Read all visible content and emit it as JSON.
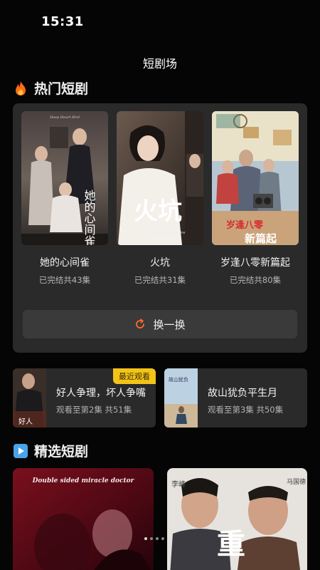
{
  "status": {
    "time": "15:31"
  },
  "page": {
    "title": "短剧场"
  },
  "hot": {
    "heading": "热门短剧",
    "icon": "fire-icon",
    "items": [
      {
        "title": "她的心间雀",
        "sub": "已完结共43集",
        "poster_text": "她的心间雀",
        "poster_tag": "Deep Heart Bird"
      },
      {
        "title": "火坑",
        "sub": "已完结共31集",
        "poster_text": "火坑",
        "poster_tag": "Salvation by the Fire"
      },
      {
        "title": "岁逢八零新篇起",
        "sub": "已完结共80集",
        "poster_text": "岁逢八零 新篇起"
      }
    ],
    "refresh_label": "换一换"
  },
  "recent": [
    {
      "title": "好人争理，坏人争嘴",
      "sub": "观看至第2集 共51集",
      "badge": "最近观看"
    },
    {
      "title": "故山犹负平生月",
      "sub": "观看至第3集 共50集"
    }
  ],
  "picks": {
    "heading": "精选短剧",
    "icon": "play-icon",
    "cards": [
      {
        "poster_text": "Double sided miracle doctor"
      },
      {
        "poster_text": "重",
        "names": [
          "李峰",
          "马国德"
        ]
      }
    ]
  },
  "colors": {
    "background": "#050505",
    "panel": "#2a2a2a",
    "accent": "#f2c318",
    "refresh_icon": "#ff6a2a"
  }
}
